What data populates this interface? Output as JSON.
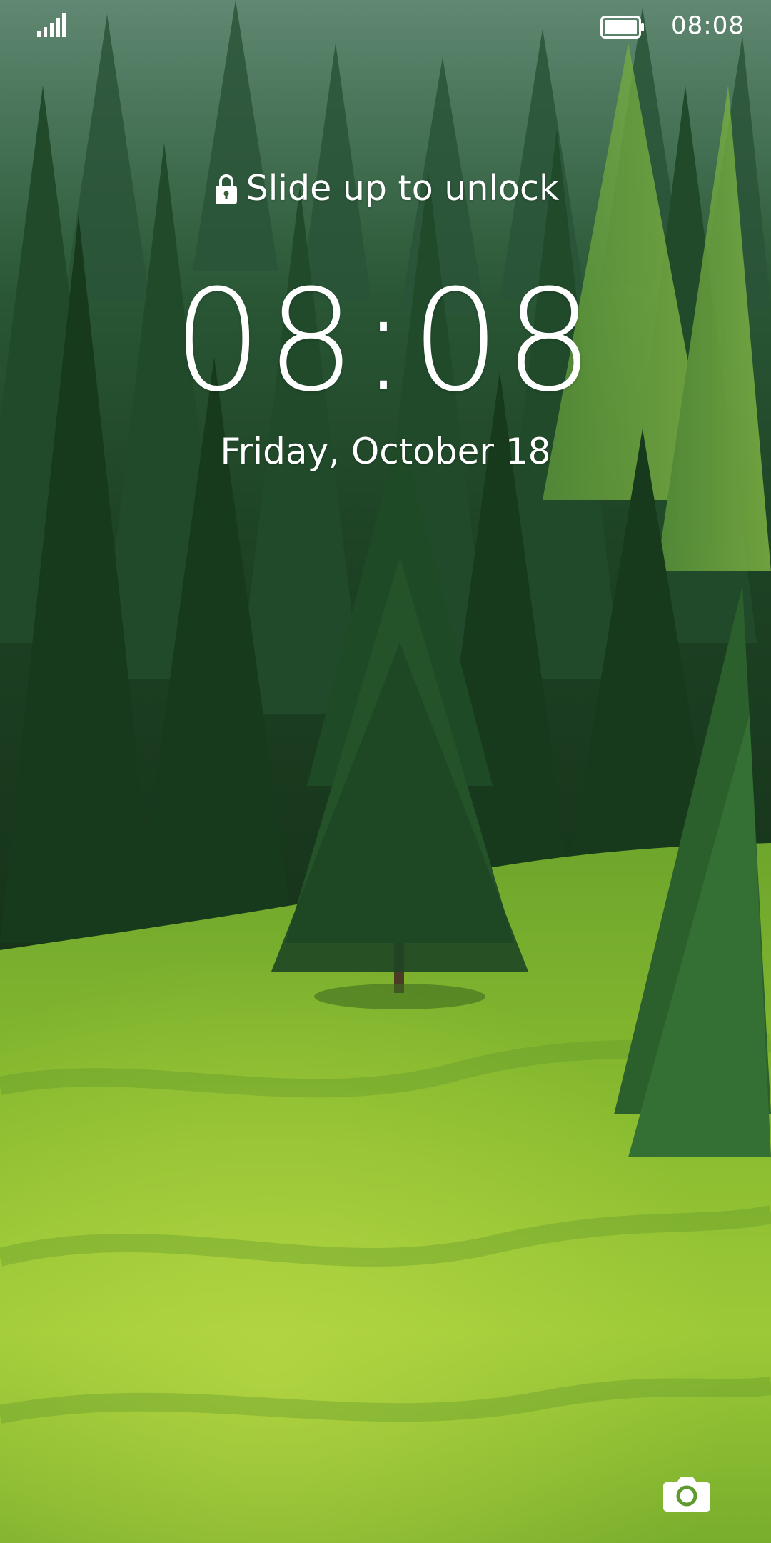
{
  "status_bar": {
    "time": "08:08",
    "signal_icon": "signal-bars-icon",
    "battery_icon": "battery-full-icon"
  },
  "lock_screen": {
    "unlock_hint": "Slide up to unlock",
    "lock_icon": "padlock-icon",
    "clock": "08:08",
    "date": "Friday, October 18",
    "camera_icon": "camera-icon"
  },
  "wallpaper": {
    "description_icon": "forest-meadow-wallpaper",
    "colors": {
      "sky_forest": "#2f5a3a",
      "dark_forest": "#18361f",
      "meadow_light": "#a9d13a",
      "meadow_dark": "#5e9a2a"
    }
  }
}
